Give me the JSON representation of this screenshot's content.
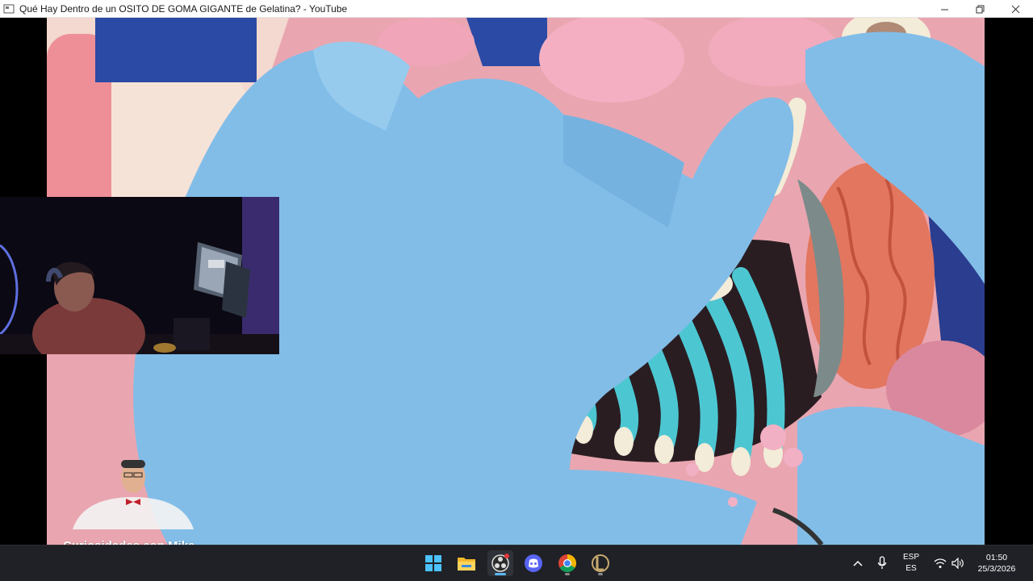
{
  "window": {
    "title": "Qué Hay Dentro de un OSITO DE GOMA GIGANTE de Gelatina? - YouTube",
    "controls": [
      "minimize-icon",
      "restore-icon",
      "close-icon"
    ]
  },
  "video": {
    "overlay_channel": "Curiosidades con Mike",
    "colors": {
      "glove": "#7fb8e6",
      "gummy_pink": "#eea4b4",
      "rib_cyan": "#4cc6d0",
      "brain": "#e8705a"
    }
  },
  "taskbar": {
    "apps": [
      {
        "name": "start-menu-icon",
        "running": false
      },
      {
        "name": "file-explorer-icon",
        "running": false
      },
      {
        "name": "obs-studio-icon",
        "running": true,
        "active": true
      },
      {
        "name": "discord-icon",
        "running": false
      },
      {
        "name": "chrome-icon",
        "running": true
      },
      {
        "name": "league-client-icon",
        "running": true
      }
    ],
    "tray": {
      "language_top": "ESP",
      "language_bottom": "ES",
      "time": "01:50",
      "date": "25/3/2026"
    }
  }
}
